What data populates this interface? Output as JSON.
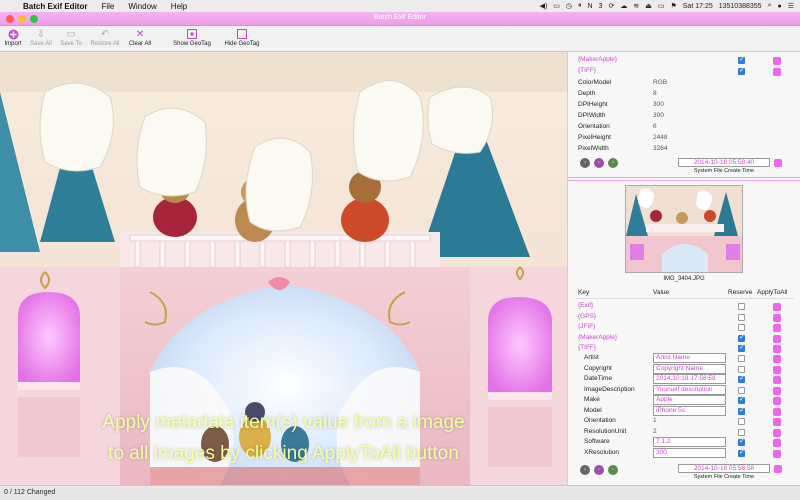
{
  "menubar": {
    "app_name": "Batch Exif Editor",
    "menus": [
      "File",
      "Window",
      "Help"
    ],
    "clock": "Sat 17:25",
    "phone": "13510388355",
    "battery_label": "3"
  },
  "window": {
    "title": "Batch Exif Editor"
  },
  "toolbar": {
    "import": "Import",
    "save_all": "Save All",
    "save_to": "Save To",
    "restore_all": "Restore All",
    "clear_all": "Clear All",
    "show_geotag": "Show GeoTag",
    "hide_geotag": "Hide GeoTag"
  },
  "caption": {
    "line1": "Apply metadata item(s) value from a image",
    "line2": "to all images by clicking ApplyToAll button"
  },
  "status": "0 / 112 Changed",
  "top_panel": {
    "groups": [
      "{MakerApple}",
      "{TIFF}"
    ],
    "rows": [
      {
        "k": "ColorModel",
        "v": "RGB"
      },
      {
        "k": "Depth",
        "v": "8"
      },
      {
        "k": "DPIHeight",
        "v": "300"
      },
      {
        "k": "DPIWidth",
        "v": "300"
      },
      {
        "k": "Orientation",
        "v": "6"
      },
      {
        "k": "PixelHeight",
        "v": "2448"
      },
      {
        "k": "PixelWidth",
        "v": "3264"
      }
    ],
    "date": "2014-10-18 05:58:40",
    "date_caption": "System File Create Time"
  },
  "bottom_panel": {
    "filename": "IMG_3404.JPG",
    "headers": {
      "key": "Key",
      "value": "Value",
      "reserve": "Reserve",
      "apply": "ApplyToAll"
    },
    "groups": [
      "{Exif}",
      "{GPS}",
      "{JFIF}",
      "{MakerApple}",
      "{TIFF}"
    ],
    "rows": [
      {
        "k": "Artist",
        "v": "Artist Name"
      },
      {
        "k": "Copyright",
        "v": "Copyright Name"
      },
      {
        "k": "DateTime",
        "v": "2014:10:18 17:58:58"
      },
      {
        "k": "ImageDescription",
        "v": "Yourself description"
      },
      {
        "k": "Make",
        "v": "Apple"
      },
      {
        "k": "Model",
        "v": "iPhone 5s"
      },
      {
        "k": "Orientation",
        "v": "1"
      },
      {
        "k": "ResolutionUnit",
        "v": "2"
      },
      {
        "k": "Software",
        "v": "7.1.2"
      },
      {
        "k": "XResolution",
        "v": "300"
      }
    ],
    "date": "2014-10-18 05:58:58",
    "date_caption": "System File Create Time"
  }
}
